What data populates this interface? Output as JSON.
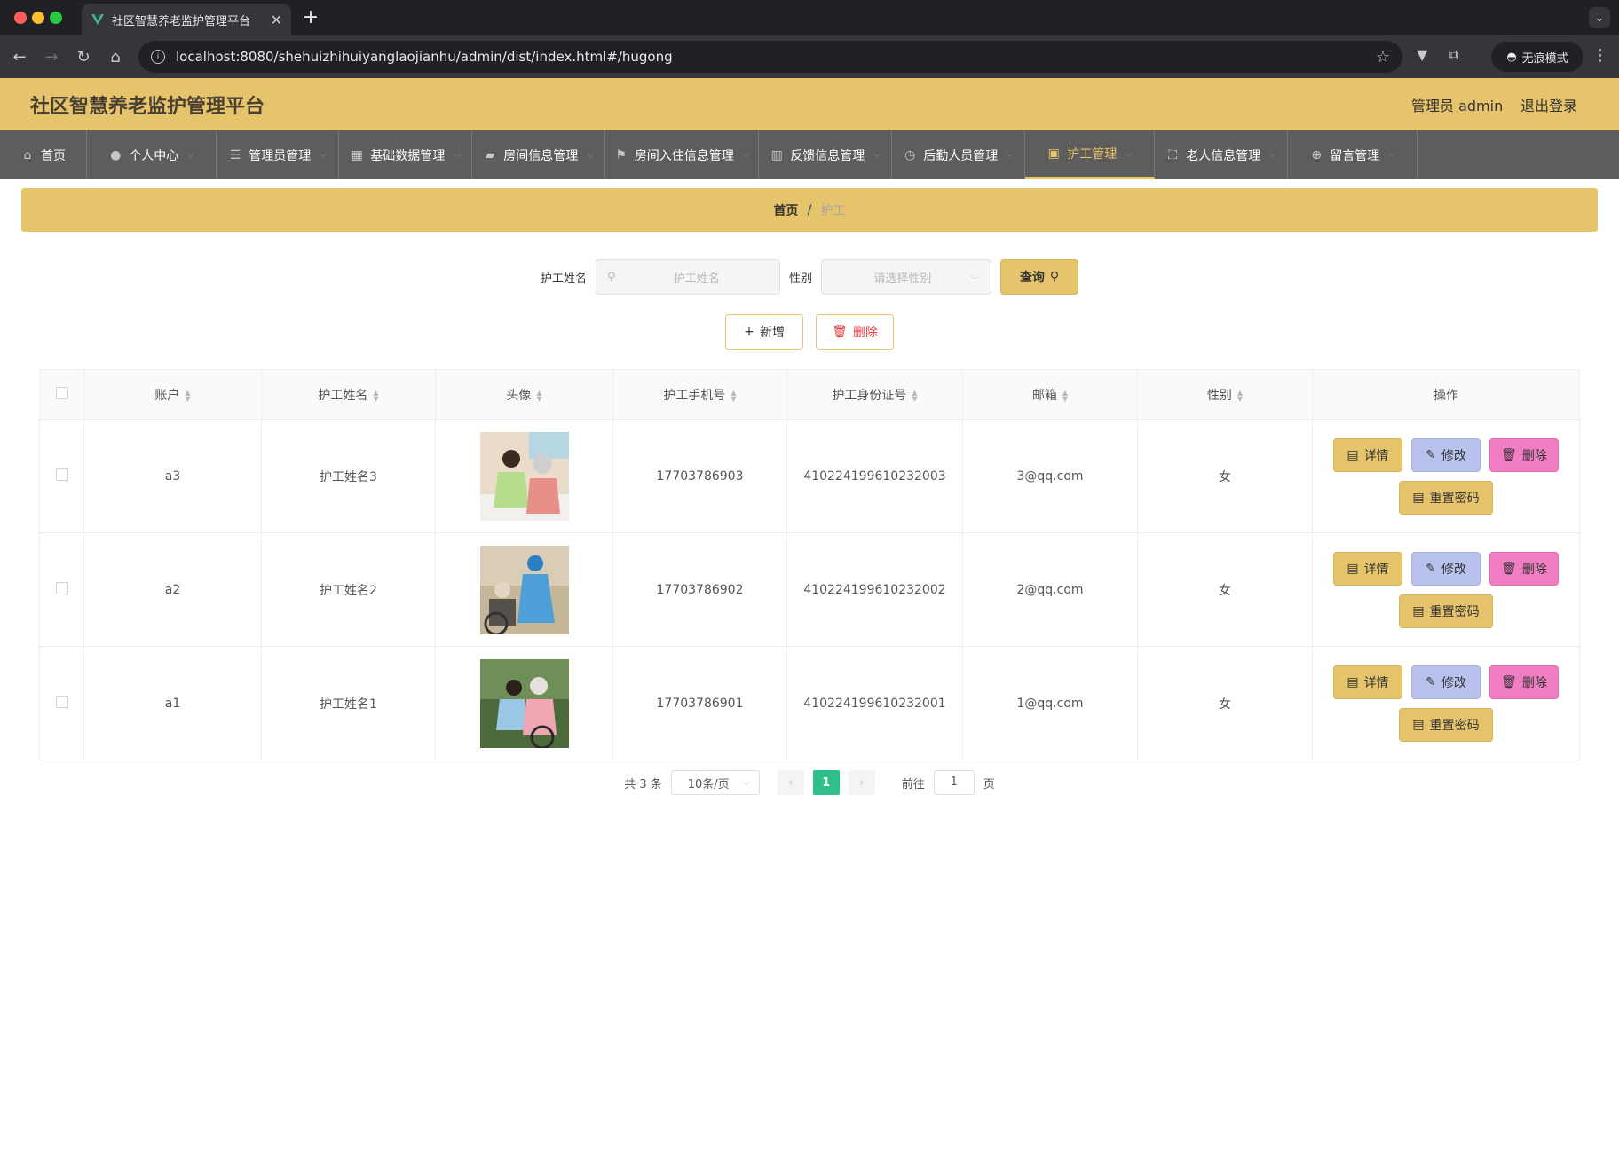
{
  "browser": {
    "tab_title": "社区智慧养老监护管理平台",
    "url": "localhost:8080/shehuizhihuiyanglaojianhu/admin/dist/index.html#/hugong",
    "incognito_label": "无痕模式"
  },
  "header": {
    "title": "社区智慧养老监护管理平台",
    "admin_label": "管理员 admin",
    "logout": "退出登录"
  },
  "menu": [
    {
      "label": "首页",
      "icon": "home-icon",
      "has_arrow": false,
      "active": false
    },
    {
      "label": "个人中心",
      "icon": "user-icon",
      "has_arrow": true,
      "active": false
    },
    {
      "label": "管理员管理",
      "icon": "list-icon",
      "has_arrow": true,
      "active": false
    },
    {
      "label": "基础数据管理",
      "icon": "grid-icon",
      "has_arrow": true,
      "active": false
    },
    {
      "label": "房间信息管理",
      "icon": "room-icon",
      "has_arrow": true,
      "active": false
    },
    {
      "label": "房间入住信息管理",
      "icon": "flag-icon",
      "has_arrow": true,
      "active": false
    },
    {
      "label": "反馈信息管理",
      "icon": "chart-icon",
      "has_arrow": true,
      "active": false
    },
    {
      "label": "后勤人员管理",
      "icon": "clock-icon",
      "has_arrow": true,
      "active": false
    },
    {
      "label": "护工管理",
      "icon": "nurse-icon",
      "has_arrow": true,
      "active": true
    },
    {
      "label": "老人信息管理",
      "icon": "fullscreen-icon",
      "has_arrow": true,
      "active": false
    },
    {
      "label": "留言管理",
      "icon": "compass-icon",
      "has_arrow": true,
      "active": false
    }
  ],
  "breadcrumb": {
    "home": "首页",
    "separator": "/",
    "current": "护工"
  },
  "search": {
    "name_label": "护工姓名",
    "name_placeholder": "护工姓名",
    "gender_label": "性别",
    "gender_placeholder": "请选择性别",
    "query_button": "查询"
  },
  "actions": {
    "add": "新增",
    "delete": "删除"
  },
  "table": {
    "columns": [
      "账户",
      "护工姓名",
      "头像",
      "护工手机号",
      "护工身份证号",
      "邮箱",
      "性别",
      "操作"
    ],
    "rows": [
      {
        "account": "a3",
        "name": "护工姓名3",
        "phone": "17703786903",
        "id_card": "410224199610232003",
        "email": "3@qq.com",
        "gender": "女"
      },
      {
        "account": "a2",
        "name": "护工姓名2",
        "phone": "17703786902",
        "id_card": "410224199610232002",
        "email": "2@qq.com",
        "gender": "女"
      },
      {
        "account": "a1",
        "name": "护工姓名1",
        "phone": "17703786901",
        "id_card": "410224199610232001",
        "email": "1@qq.com",
        "gender": "女"
      }
    ],
    "row_actions": {
      "detail": "详情",
      "edit": "修改",
      "delete": "删除",
      "reset": "重置密码"
    }
  },
  "pagination": {
    "total": "共 3 条",
    "page_size": "10条/页",
    "current_page": "1",
    "goto_label": "前往",
    "goto_value": "1",
    "page_unit": "页"
  },
  "colors": {
    "accent": "#e6c46b",
    "menu_bg": "#5d5d5d",
    "page_active": "#2fbf8a",
    "danger": "#e8383d"
  }
}
